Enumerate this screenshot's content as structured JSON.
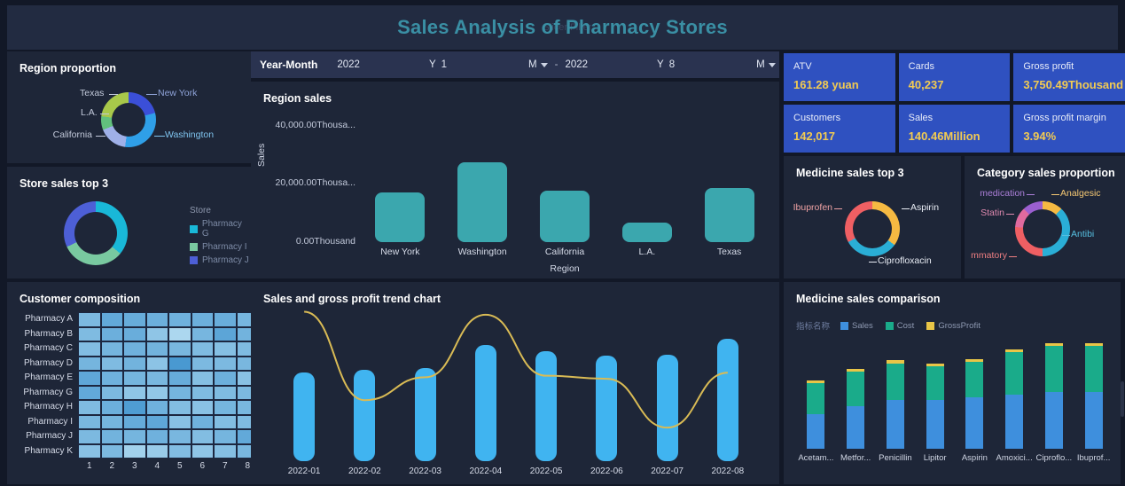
{
  "header": {
    "title": "Sales Analysis of Pharmacy Stores",
    "watermark": "Slicer/Filter"
  },
  "filter_bar": {
    "label": "Year-Month",
    "start_year": "2022",
    "start_year_unit": "Y",
    "start_month": "1",
    "start_month_unit": "M",
    "separator": "-",
    "end_year": "2022",
    "end_year_unit": "Y",
    "end_month": "8",
    "end_month_unit": "M"
  },
  "kpi_cards": [
    {
      "label": "ATV",
      "value": "161.28 yuan"
    },
    {
      "label": "Cards",
      "value": "40,237"
    },
    {
      "label": "Gross profit",
      "value": "3,750.49Thousand"
    },
    {
      "label": "Customers",
      "value": "142,017"
    },
    {
      "label": "Sales",
      "value": "140.46Million"
    },
    {
      "label": "Gross profit margin",
      "value": "3.94%"
    }
  ],
  "panels": {
    "region_proportion": "Region proportion",
    "store_sales_top3": "Store sales top 3",
    "customer_composition": "Customer composition",
    "region_sales": "Region sales",
    "sales_trend": "Sales and gross profit trend chart",
    "medicine_top3": "Medicine sales top 3",
    "category_proportion": "Category sales proportion",
    "medicine_comparison": "Medicine sales comparison"
  },
  "chart_data": [
    {
      "id": "region_proportion",
      "type": "pie",
      "title": "Region proportion",
      "labels": [
        "New York",
        "Washington",
        "California",
        "L.A.",
        "Texas"
      ],
      "values": [
        21,
        31,
        17,
        8,
        23
      ],
      "colors": [
        "#3b4fd8",
        "#2f9fe8",
        "#9fb0e8",
        "#62c07d",
        "#a8c84a"
      ],
      "legend": "labels-outside"
    },
    {
      "id": "store_sales_top3",
      "type": "pie",
      "title": "Store sales top 3",
      "legend_title": "Store",
      "labels": [
        "Pharmacy G",
        "Pharmacy I",
        "Pharmacy J"
      ],
      "values": [
        36,
        32,
        32
      ],
      "colors": [
        "#19b8d8",
        "#79c9a0",
        "#4d5fd6"
      ],
      "legend": "right"
    },
    {
      "id": "customer_composition",
      "type": "heatmap",
      "title": "Customer composition",
      "rows": [
        "Pharmacy A",
        "Pharmacy B",
        "Pharmacy C",
        "Pharmacy D",
        "Pharmacy E",
        "Pharmacy G",
        "Pharmacy H",
        "Pharmacy I",
        "Pharmacy J",
        "Pharmacy K"
      ],
      "columns": [
        "1",
        "2",
        "3",
        "4",
        "5",
        "6",
        "7",
        "8"
      ],
      "values": [
        [
          0.42,
          0.58,
          0.55,
          0.52,
          0.5,
          0.52,
          0.54,
          0.45
        ],
        [
          0.4,
          0.52,
          0.54,
          0.3,
          0.12,
          0.45,
          0.62,
          0.48
        ],
        [
          0.38,
          0.46,
          0.5,
          0.48,
          0.44,
          0.4,
          0.36,
          0.4
        ],
        [
          0.46,
          0.4,
          0.48,
          0.32,
          0.74,
          0.42,
          0.42,
          0.44
        ],
        [
          0.6,
          0.5,
          0.46,
          0.44,
          0.55,
          0.36,
          0.52,
          0.34
        ],
        [
          0.58,
          0.42,
          0.3,
          0.28,
          0.46,
          0.4,
          0.4,
          0.42
        ],
        [
          0.4,
          0.52,
          0.7,
          0.5,
          0.38,
          0.34,
          0.46,
          0.44
        ],
        [
          0.44,
          0.46,
          0.56,
          0.6,
          0.34,
          0.5,
          0.38,
          0.4
        ],
        [
          0.42,
          0.48,
          0.46,
          0.5,
          0.44,
          0.38,
          0.46,
          0.58
        ],
        [
          0.34,
          0.42,
          0.18,
          0.24,
          0.38,
          0.3,
          0.36,
          0.44
        ]
      ],
      "colorscale": [
        "#bfe3f5",
        "#1f7fc4"
      ]
    },
    {
      "id": "region_sales",
      "type": "bar",
      "title": "Region sales",
      "xlabel": "Region",
      "ylabel": "Sales",
      "categories": [
        "New York",
        "Washington",
        "California",
        "L.A.",
        "Texas"
      ],
      "values": [
        17000,
        27500,
        17800,
        6600,
        18500
      ],
      "ytick_labels": [
        "40,000.00Thousa...",
        "20,000.00Thousa...",
        "0.00Thousand"
      ],
      "ytick_values": [
        40000,
        20000,
        0
      ],
      "ylim": [
        0,
        46000
      ],
      "bar_color": "#3ba7ae",
      "grid": false
    },
    {
      "id": "sales_trend",
      "type": "bar",
      "title": "Sales and gross profit trend chart",
      "categories": [
        "2022-01",
        "2022-02",
        "2022-03",
        "2022-04",
        "2022-05",
        "2022-06",
        "2022-07",
        "2022-08"
      ],
      "series": [
        {
          "name": "Sales",
          "type": "bar",
          "values": [
            58,
            60,
            61,
            76,
            72,
            69,
            70,
            80
          ],
          "color": "#40b4f0"
        },
        {
          "name": "GrossProfit",
          "type": "line",
          "values": [
            98,
            40,
            55,
            96,
            56,
            54,
            22,
            58
          ],
          "color": "#d9bb55"
        }
      ],
      "grid": false
    },
    {
      "id": "medicine_top3",
      "type": "pie",
      "title": "Medicine sales top 3",
      "labels": [
        "Aspirin",
        "Ciprofloxacin",
        "Ibuprofen"
      ],
      "values": [
        35,
        32,
        33
      ],
      "colors": [
        "#f5b942",
        "#2aaed6",
        "#ef5f63"
      ],
      "legend": "labels-outside"
    },
    {
      "id": "category_proportion",
      "type": "pie",
      "title": "Category sales proportion",
      "labels": [
        "Analgesic",
        "Antibi",
        "mmatory",
        "Statin",
        "medication"
      ],
      "full_labels": [
        "Analgesic",
        "Antibiotic",
        "Anti-inflammatory",
        "Statin",
        "Diabetes medication"
      ],
      "values": [
        12,
        38,
        26,
        12,
        12
      ],
      "colors": [
        "#f5b942",
        "#2aaed6",
        "#ef5f63",
        "#e06a9e",
        "#9b5fd0"
      ],
      "legend": "labels-outside"
    },
    {
      "id": "medicine_comparison",
      "type": "bar",
      "title": "Medicine sales comparison",
      "legend_title": "指标名称",
      "categories": [
        "Acetam...",
        "Metfor...",
        "Penicillin",
        "Lipitor",
        "Aspirin",
        "Amoxici...",
        "Ciproflo...",
        "Ibuprof..."
      ],
      "series": [
        {
          "name": "Sales",
          "values": [
            24,
            30,
            34,
            34,
            36,
            38,
            40,
            40
          ],
          "color": "#3e8fdd"
        },
        {
          "name": "Cost",
          "values": [
            22,
            24,
            26,
            24,
            25,
            30,
            32,
            32
          ],
          "color": "#1aab8a"
        },
        {
          "name": "GrossProfit",
          "values": [
            2,
            2,
            2,
            2,
            2,
            2,
            2,
            2
          ],
          "color": "#e8c547"
        }
      ],
      "stacked": true,
      "grid": false
    }
  ]
}
